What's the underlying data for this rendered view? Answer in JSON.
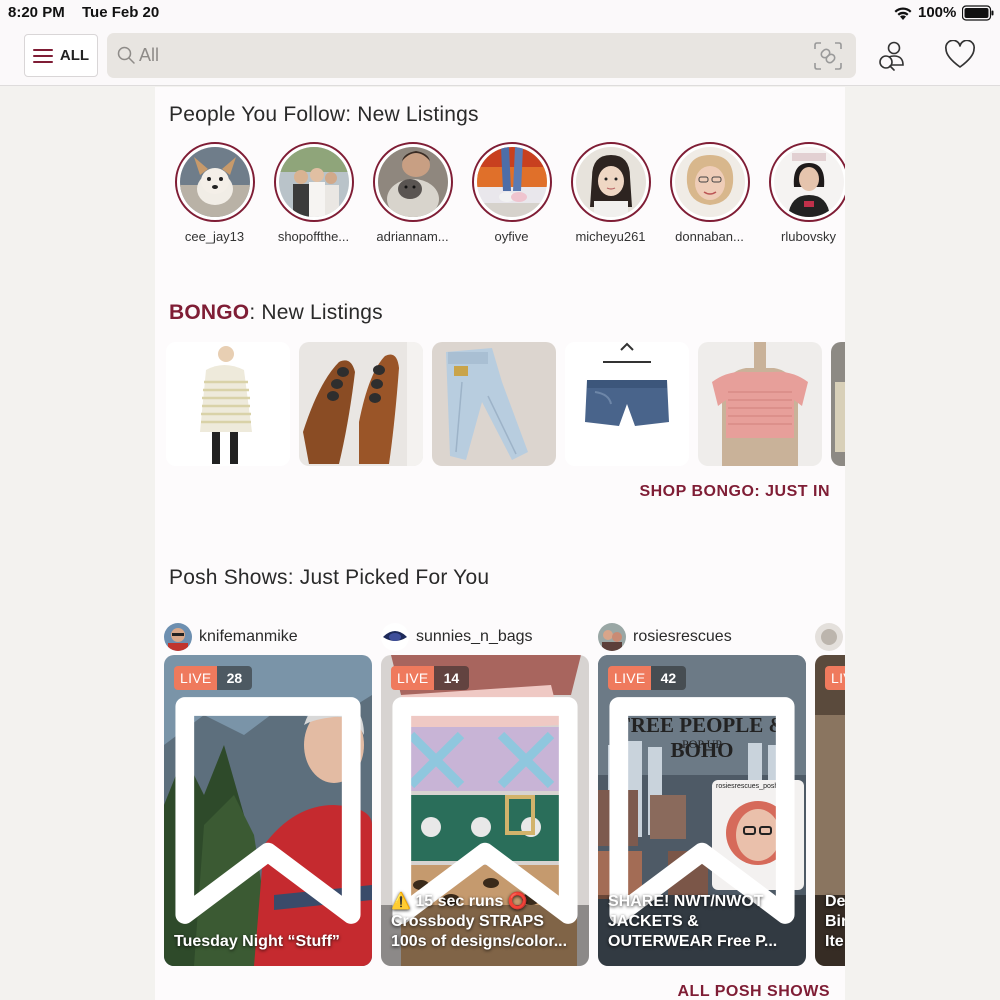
{
  "status_bar": {
    "time": "8:20 PM",
    "date": "Tue Feb 20",
    "battery": "100%",
    "icons": [
      "wifi-icon",
      "battery-icon"
    ]
  },
  "header": {
    "menu_label": "ALL",
    "search_placeholder": "All",
    "icons": [
      "hamburger-icon",
      "search-icon",
      "link-scan-icon",
      "people-icon",
      "heart-icon"
    ]
  },
  "follow_section": {
    "title": "People You Follow: New Listings",
    "users": [
      {
        "name": "cee_jay13"
      },
      {
        "name": "shopoffthe..."
      },
      {
        "name": "adriannam..."
      },
      {
        "name": "oyfive"
      },
      {
        "name": "micheyu261"
      },
      {
        "name": "donnaban..."
      },
      {
        "name": "rlubovsky"
      }
    ]
  },
  "brand_section": {
    "brand": "BONGO",
    "title_suffix": ": New Listings",
    "listings": [
      "striped sweater dress",
      "brown sandals",
      "light wash jeans",
      "denim shorts",
      "pink smocked top",
      "partial item"
    ],
    "shop_link": "SHOP BONGO: JUST IN"
  },
  "shows_section": {
    "title": "Posh Shows: Just Picked For You",
    "shows": [
      {
        "host": "knifemanmike",
        "live": "LIVE",
        "viewers": "28",
        "caption": "Tuesday Night “Stuff”"
      },
      {
        "host": "sunnies_n_bags",
        "live": "LIVE",
        "viewers": "14",
        "caption": "⚠️ 15 sec runs ⭕\nCrossbody STRAPS\n100s of designs/color..."
      },
      {
        "host": "rosiesrescues",
        "live": "LIVE",
        "viewers": "42",
        "caption": "SHARE! NWT/NWOT\nJACKETS &\nOUTERWEAR Free P...",
        "overlay_title": "FREE PEOPLE & BOHO",
        "overlay_subtitle": "POP UP",
        "overlay_handle": "rosiesrescues_posh"
      },
      {
        "host": "",
        "live": "LIV",
        "viewers": "",
        "caption": "De\nBir\nIte"
      }
    ],
    "all_link": "ALL POSH SHOWS"
  },
  "colors": {
    "accent": "#7f1d35",
    "live": "#ef7a5d",
    "background": "#f3f2ef"
  }
}
